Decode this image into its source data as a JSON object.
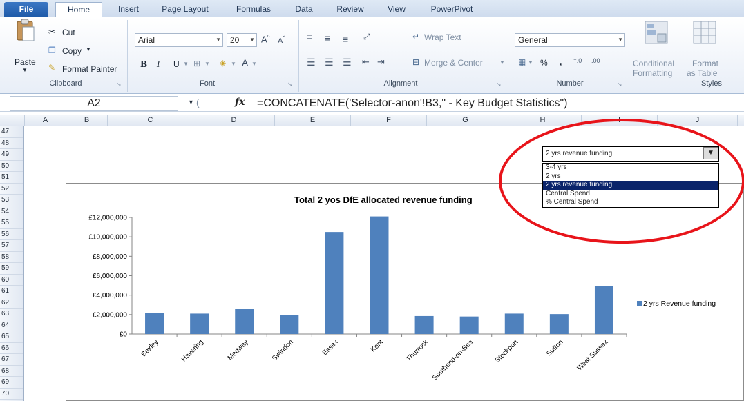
{
  "ribbon": {
    "tabs": [
      "File",
      "Home",
      "Insert",
      "Page Layout",
      "Formulas",
      "Data",
      "Review",
      "View",
      "PowerPivot"
    ],
    "clipboard": {
      "paste": "Paste",
      "cut": "Cut",
      "copy": "Copy",
      "format_painter": "Format Painter",
      "label": "Clipboard"
    },
    "font": {
      "name": "Arial",
      "size": "20",
      "bold": "B",
      "italic": "I",
      "underline": "U",
      "label": "Font"
    },
    "alignment": {
      "wrap_text": "Wrap Text",
      "merge_center": "Merge & Center",
      "label": "Alignment"
    },
    "number": {
      "format": "General",
      "percent": "%",
      "comma": ",",
      "label": "Number"
    },
    "styles": {
      "conditional": "Conditional",
      "formatting": "Formatting",
      "format": "Format",
      "as_table": "as Table",
      "label": "Styles"
    }
  },
  "formula_bar": {
    "name_box": "A2",
    "fx": "fx",
    "formula": "=CONCATENATE('Selector-anon'!B3,\" - Key Budget Statistics\")"
  },
  "sheet": {
    "columns": [
      "A",
      "B",
      "C",
      "D",
      "E",
      "F",
      "G",
      "H",
      "I",
      "J"
    ],
    "rows": [
      "47",
      "48",
      "49",
      "50",
      "51",
      "52",
      "53",
      "54",
      "55",
      "56",
      "57",
      "58",
      "59",
      "60",
      "61",
      "62",
      "63",
      "64",
      "65",
      "66",
      "67",
      "68",
      "69",
      "70"
    ]
  },
  "dropdown": {
    "selected": "2 yrs revenue funding",
    "options": [
      "3-4 yrs",
      "2 yrs",
      "2 yrs revenue funding",
      "Central Spend",
      "% Central Spend"
    ]
  },
  "colors": {
    "bar": "#4f81bd",
    "highlight": "#e8141a",
    "selected_option": "#0a246a"
  },
  "chart_data": {
    "type": "bar",
    "title": "Total 2 yos DfE allocated revenue funding",
    "categories": [
      "Bexley",
      "Havering",
      "Medway",
      "Swindon",
      "Essex",
      "Kent",
      "Thurrock",
      "Southend-on-Sea",
      "Stockport",
      "Sutton",
      "West Sussex"
    ],
    "series": [
      {
        "name": "2 yrs Revenue funding",
        "values": [
          2200000,
          2100000,
          2600000,
          1950000,
          10500000,
          12100000,
          1850000,
          1800000,
          2100000,
          2050000,
          4900000
        ]
      }
    ],
    "ylim": [
      0,
      12000000
    ],
    "yticks": [
      "£0",
      "£2,000,000",
      "£4,000,000",
      "£6,000,000",
      "£8,000,000",
      "£10,000,000",
      "£12,000,000"
    ],
    "legend": "right",
    "grid": false
  }
}
